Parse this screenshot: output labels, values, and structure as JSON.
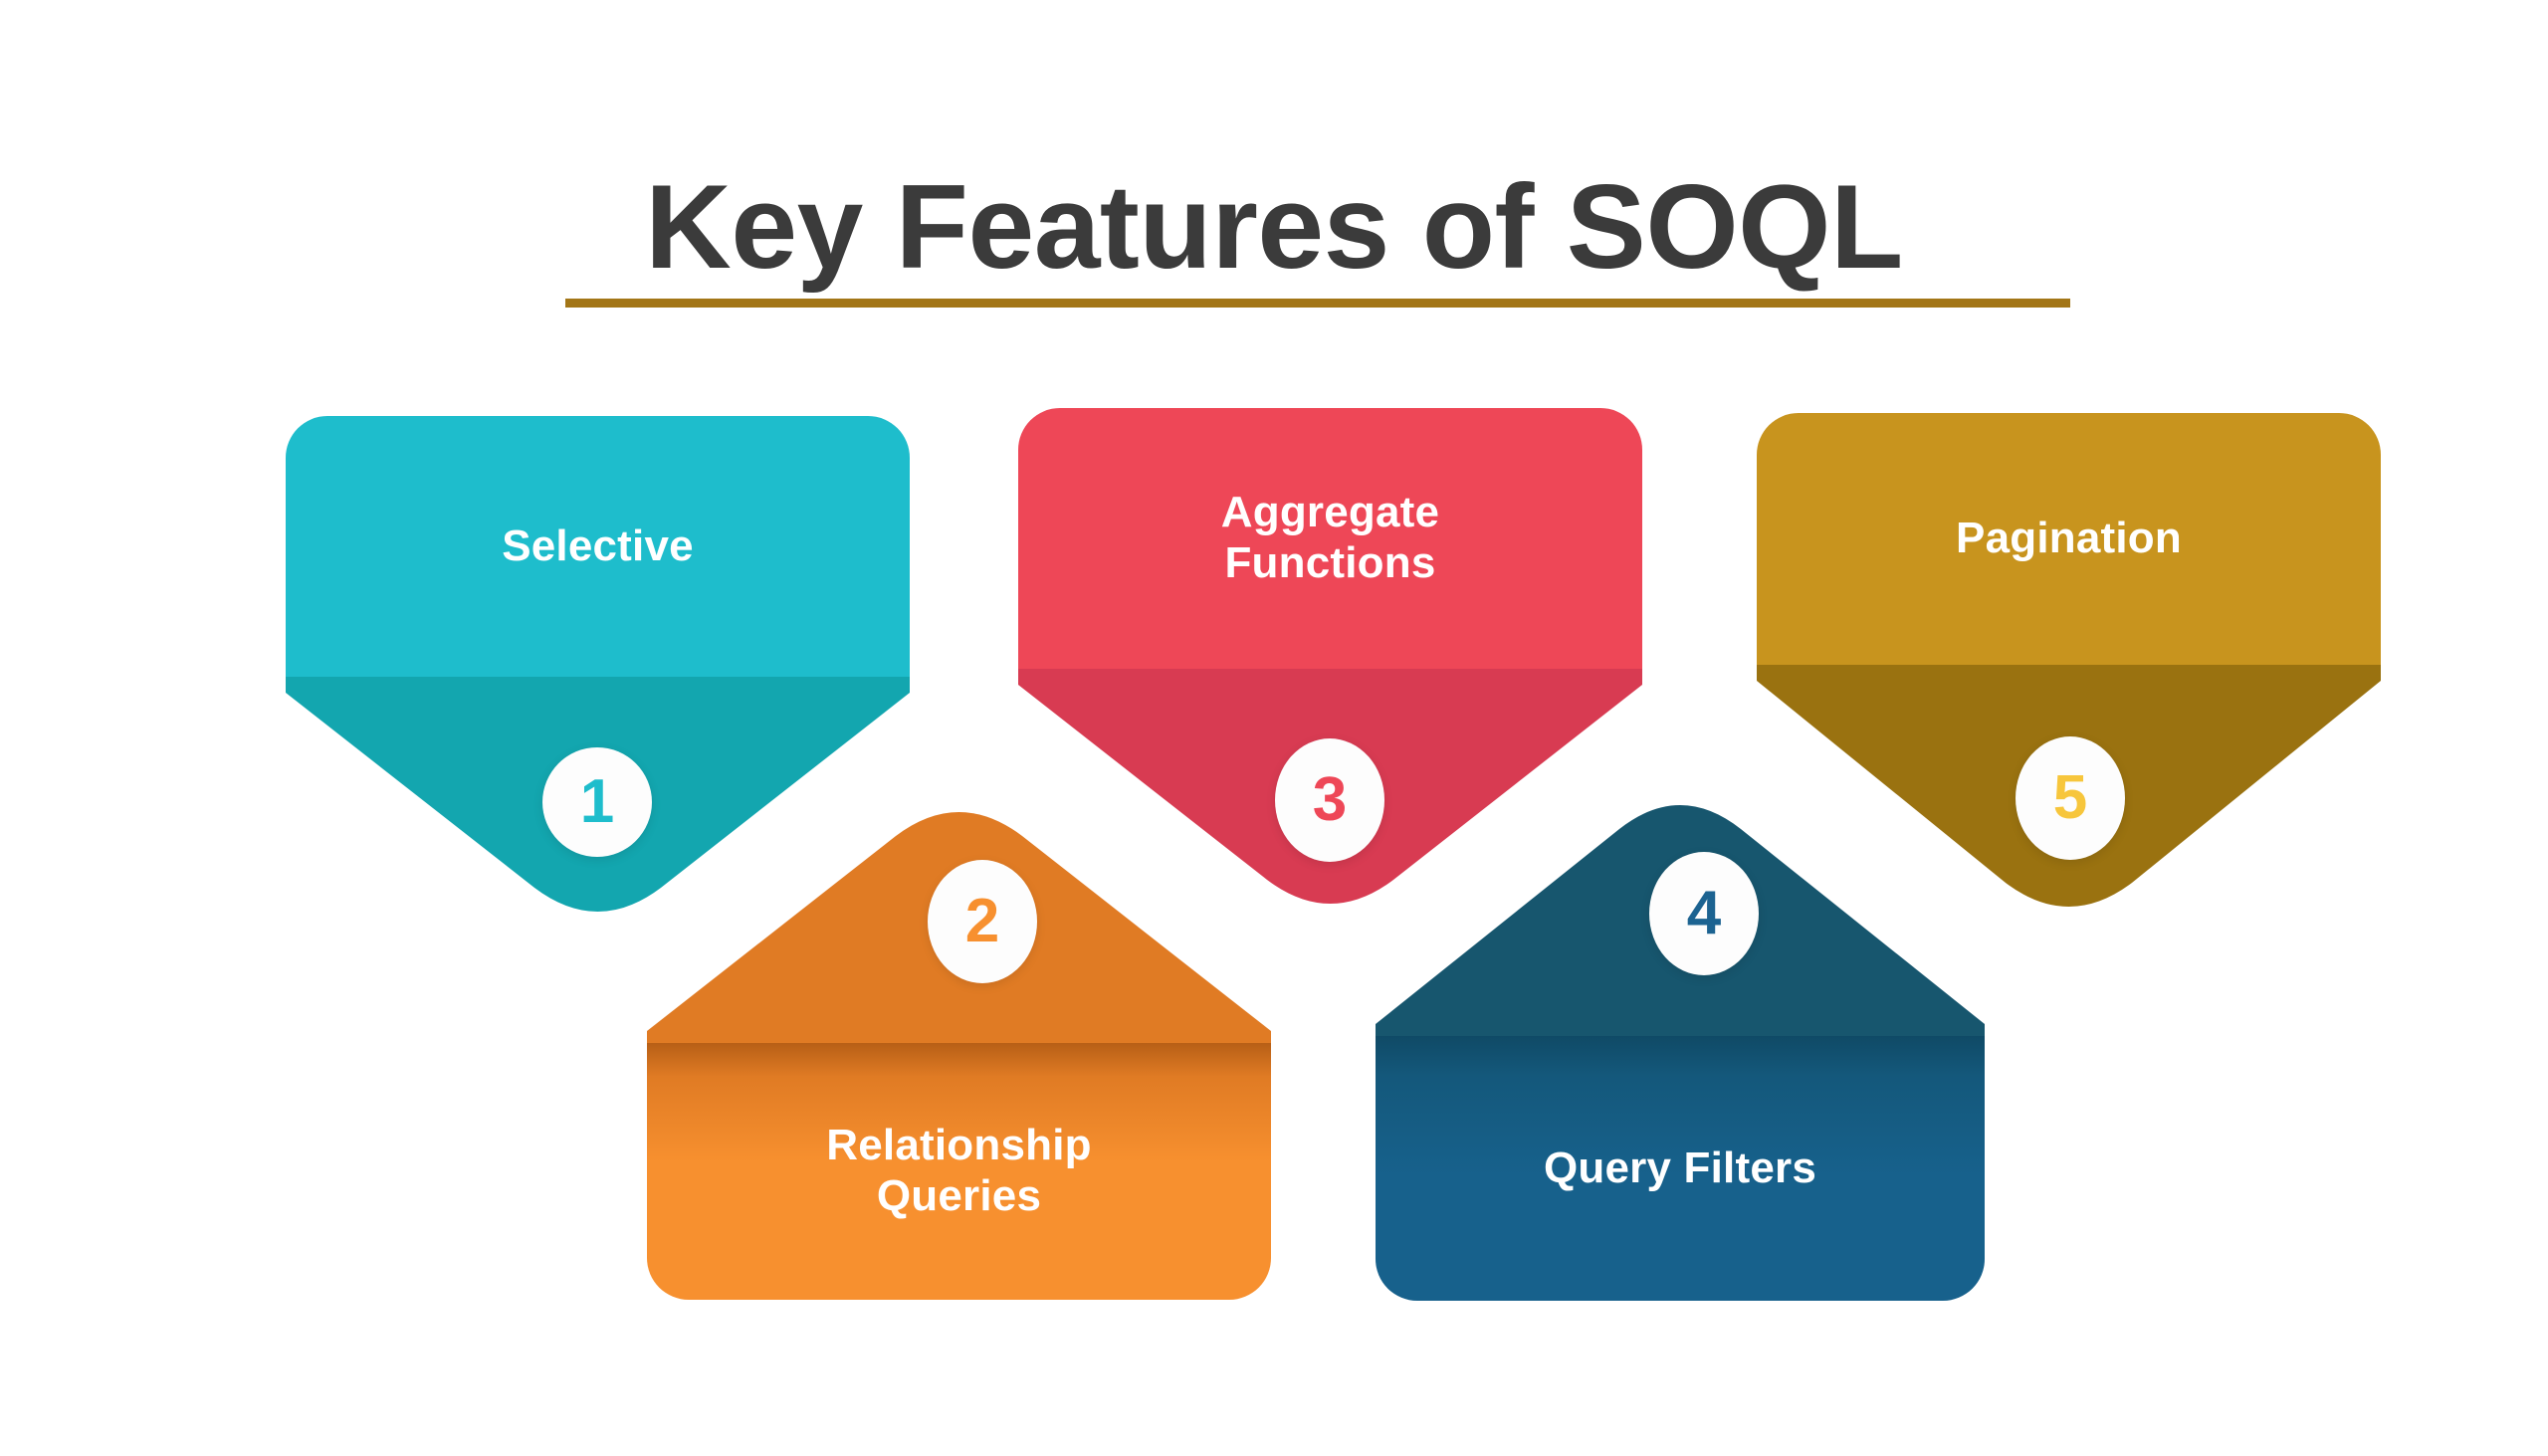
{
  "title": {
    "text": "Key Features of SOQL",
    "color": "#3b3b3b",
    "underline_color": "#A37617"
  },
  "background_color": "#ffffff",
  "cards": [
    {
      "number": "1",
      "label": "Selective",
      "orientation": "down",
      "fill_color": "#1EBDCC",
      "triangle_color": "#13A6AF",
      "number_color": "#1EBDCC"
    },
    {
      "number": "2",
      "label": "Relationship\nQueries",
      "orientation": "up",
      "fill_color": "#F7902F",
      "triangle_color": "#E07B24",
      "number_color": "#F7902F"
    },
    {
      "number": "3",
      "label": "Aggregate\nFunctions",
      "orientation": "down",
      "fill_color": "#EE4757",
      "triangle_color": "#D83B52",
      "number_color": "#EE4757"
    },
    {
      "number": "4",
      "label": "Query Filters",
      "orientation": "up",
      "fill_color": "#17618C",
      "triangle_color": "#17566E",
      "number_color": "#1C6391"
    },
    {
      "number": "5",
      "label": "Pagination",
      "orientation": "down",
      "fill_color": "#C8941E",
      "triangle_color": "#9A7210",
      "number_color": "#F7C63C"
    }
  ]
}
